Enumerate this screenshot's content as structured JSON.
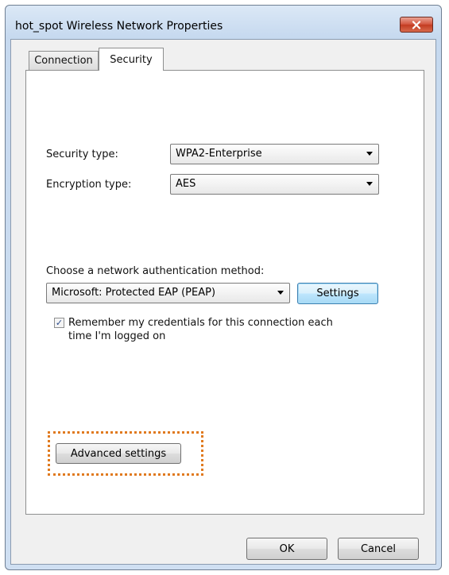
{
  "window": {
    "title": "hot_spot Wireless Network Properties"
  },
  "tabs": [
    {
      "label": "Connection",
      "selected": false
    },
    {
      "label": "Security",
      "selected": true
    }
  ],
  "security": {
    "security_type_label": "Security type:",
    "security_type_value": "WPA2-Enterprise",
    "encryption_type_label": "Encryption type:",
    "encryption_type_value": "AES",
    "auth_method_label": "Choose a network authentication method:",
    "auth_method_value": "Microsoft: Protected EAP (PEAP)",
    "settings_button": "Settings",
    "remember_checked": true,
    "remember_line1": "Remember my credentials for this connection each",
    "remember_line2": "time I'm logged on",
    "advanced_button": "Advanced settings"
  },
  "footer": {
    "ok_label": "OK",
    "cancel_label": "Cancel"
  },
  "colors": {
    "highlight": "#e07a1f",
    "close_button": "#c23b21"
  }
}
